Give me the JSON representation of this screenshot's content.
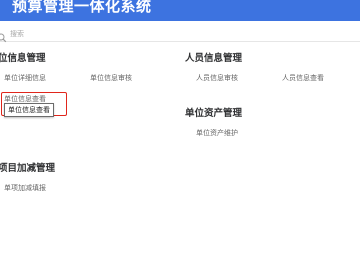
{
  "app": {
    "title": "预算管理一体化系统"
  },
  "search": {
    "placeholder": "搜索"
  },
  "sections": {
    "unit_info": {
      "title": "位信息管理",
      "items": [
        "单位详细信息",
        "单位信息审核",
        "单位信息查看"
      ]
    },
    "personnel_info": {
      "title": "人员信息管理",
      "items": [
        "人员信息审核",
        "人员信息查看"
      ]
    },
    "unit_assets": {
      "title": "单位资产管理",
      "items": [
        "单位资产维护"
      ]
    },
    "project_adjust": {
      "title": "项目加减管理",
      "items": [
        "单项加减填报"
      ]
    }
  },
  "tooltip": {
    "text": "单位信息查看"
  },
  "colors": {
    "header": "#3d73e0",
    "highlight": "#e0261c"
  }
}
